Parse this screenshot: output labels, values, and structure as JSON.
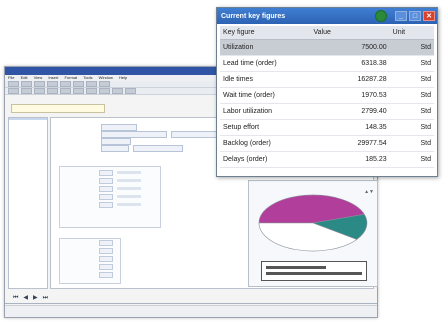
{
  "background_app": {
    "title": "",
    "menu": [
      "File",
      "Edit",
      "View",
      "Insert",
      "Format",
      "Tools",
      "Window",
      "Help"
    ],
    "field_label": "",
    "field_value": "",
    "tree_items": [
      "",
      "",
      ""
    ],
    "section1": "",
    "section2": "",
    "status": [
      "",
      "",
      "",
      "",
      ""
    ]
  },
  "chart": {
    "type": "pie",
    "values": [
      45,
      15,
      40
    ],
    "colors": [
      "#b23e9b",
      "#2c8a86",
      "#ffffff"
    ]
  },
  "dialog": {
    "title": "Current key figures",
    "columns": [
      "Key figure",
      "Value",
      "Unit"
    ],
    "rows": [
      {
        "name": "Utilization",
        "value": "7500.00",
        "unit": "Std"
      },
      {
        "name": "Lead time (order)",
        "value": "6318.38",
        "unit": "Std"
      },
      {
        "name": "Idle times",
        "value": "16287.28",
        "unit": "Std"
      },
      {
        "name": "Wait time (order)",
        "value": "1970.53",
        "unit": "Std"
      },
      {
        "name": "Labor utilization",
        "value": "2799.40",
        "unit": "Std"
      },
      {
        "name": "Setup effort",
        "value": "148.35",
        "unit": "Std"
      },
      {
        "name": "Backlog (order)",
        "value": "29977.54",
        "unit": "Std"
      },
      {
        "name": "Delays (order)",
        "value": "185.23",
        "unit": "Std"
      }
    ],
    "highlight_row": 0,
    "colors": {
      "titlebar": "#2d62b3",
      "status_dot": "#2a8a3a",
      "close": "#d8432f"
    }
  }
}
